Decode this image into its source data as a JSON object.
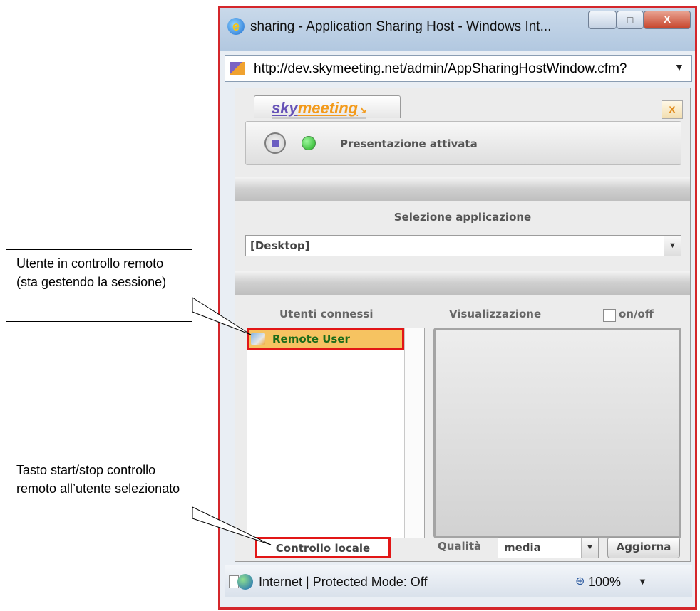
{
  "callouts": {
    "remote_user": "Utente in controllo remoto (sta gestendo la sessione)",
    "start_stop": "Tasto start/stop controllo remoto all’utente selezionato"
  },
  "window": {
    "title": "sharing - Application Sharing Host - Windows Int...",
    "url": "http://dev.skymeeting.net/admin/AppSharingHostWindow.cfm?",
    "minimize_icon": "minimize-icon",
    "maximize_icon": "maximize-icon",
    "close_label": "X"
  },
  "app": {
    "logo_sky": "sky",
    "logo_meeting": "meeting",
    "close_label": "x",
    "status_text": "Presentazione attivata",
    "app_selection_heading": "Selezione applicazione",
    "app_selected": "[Desktop]",
    "users_heading": "Utenti connessi",
    "preview_heading": "Visualizzazione",
    "onoff_label": "on/off",
    "users": [
      {
        "name": "Remote User"
      }
    ],
    "local_control_button": "Controllo locale",
    "quality_label": "Qualità",
    "quality_value": "media",
    "refresh_button": "Aggiorna"
  },
  "statusbar": {
    "zone_text": "Internet | Protected Mode: Off",
    "zoom": "100%"
  },
  "colors": {
    "highlight_border": "#e21616",
    "selected_user_bg": "#f6c361",
    "window_frame": "#d4262b"
  }
}
